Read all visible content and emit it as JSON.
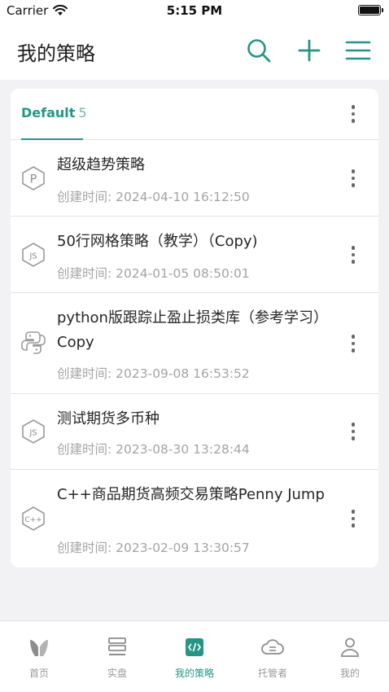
{
  "status_bar": {
    "carrier": "Carrier",
    "time": "5:15 PM"
  },
  "header": {
    "title": "我的策略"
  },
  "group": {
    "name": "Default",
    "count": "5"
  },
  "strategies": [
    {
      "name": "超级趋势策略",
      "created": "创建时间: 2024-04-10 16:12:50",
      "lang_icon": "python-p-icon"
    },
    {
      "name": "50行网格策略（教学）（Copy)",
      "created": "创建时间: 2024-01-05 08:50:01",
      "lang_icon": "javascript-icon"
    },
    {
      "name": "python版跟踪止盈止损类库（参考学习）Copy",
      "created": "创建时间: 2023-09-08 16:53:52",
      "lang_icon": "python-icon"
    },
    {
      "name": "测试期货多币种",
      "created": "创建时间: 2023-08-30 13:28:44",
      "lang_icon": "javascript-icon"
    },
    {
      "name": "C++商品期货高频交易策略Penny Jump",
      "created": "创建时间: 2023-02-09 13:30:57",
      "lang_icon": "cpp-icon"
    }
  ],
  "tabbar": {
    "items": [
      {
        "label": "首页"
      },
      {
        "label": "实盘"
      },
      {
        "label": "我的策略"
      },
      {
        "label": "托管者"
      },
      {
        "label": "我的"
      }
    ]
  },
  "colors": {
    "accent": "#259684",
    "background": "#f2f2f4",
    "muted_text": "#a4a4a4"
  }
}
